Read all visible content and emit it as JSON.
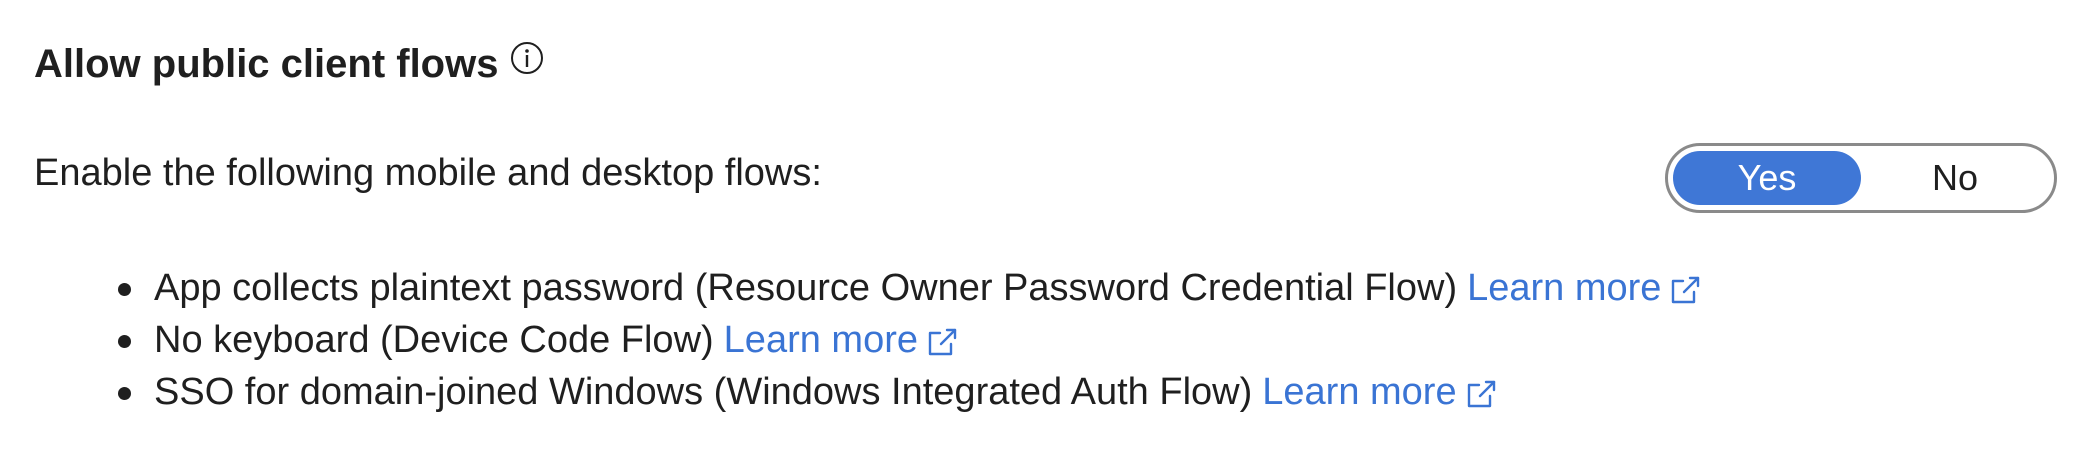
{
  "section": {
    "title": "Allow public client flows",
    "info_icon": "info-icon",
    "description": "Enable the following mobile and desktop flows:"
  },
  "toggle": {
    "options": [
      "Yes",
      "No"
    ],
    "selected": "Yes",
    "accent_color": "#3f77d6"
  },
  "flows": [
    {
      "text": "App collects plaintext password (Resource Owner Password Credential Flow)",
      "link": "Learn more",
      "link_icon": "external-link-icon"
    },
    {
      "text": "No keyboard (Device Code Flow)",
      "link": "Learn more",
      "link_icon": "external-link-icon"
    },
    {
      "text": "SSO for domain-joined Windows (Windows Integrated Auth Flow)",
      "link": "Learn more",
      "link_icon": "external-link-icon"
    }
  ],
  "colors": {
    "link": "#3a74d4",
    "text": "#1f1f1f"
  }
}
